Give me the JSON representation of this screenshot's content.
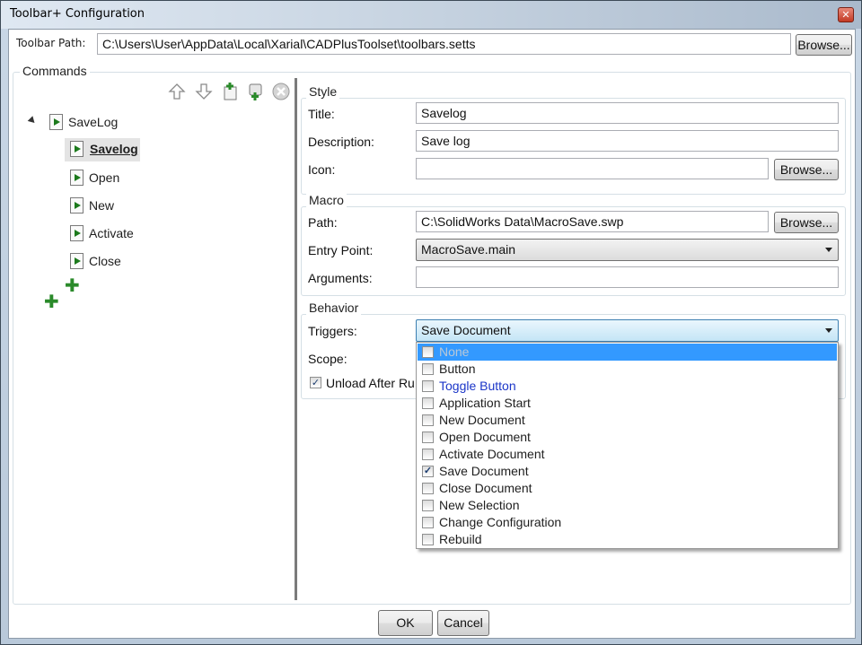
{
  "window": {
    "title": "Toolbar+ Configuration",
    "close_glyph": "✕"
  },
  "path_row": {
    "label": "Toolbar Path:",
    "value": "C:\\Users\\User\\AppData\\Local\\Xarial\\CADPlusToolset\\toolbars.setts",
    "browse": "Browse..."
  },
  "commands": {
    "legend": "Commands",
    "toolbar_icons": [
      "arrow-up-icon",
      "arrow-down-icon",
      "add-command-icon",
      "add-group-icon",
      "remove-icon"
    ],
    "root": {
      "label": "SaveLog",
      "expanded": true
    },
    "children": [
      {
        "label": "Savelog",
        "selected": true
      },
      {
        "label": "Open"
      },
      {
        "label": "New"
      },
      {
        "label": "Activate"
      },
      {
        "label": "Close"
      }
    ]
  },
  "style": {
    "legend": "Style",
    "title_label": "Title:",
    "title_value": "Savelog",
    "description_label": "Description:",
    "description_value": "Save log",
    "icon_label": "Icon:",
    "icon_value": "",
    "browse": "Browse..."
  },
  "macro": {
    "legend": "Macro",
    "path_label": "Path:",
    "path_value": "C:\\SolidWorks Data\\MacroSave.swp",
    "browse": "Browse...",
    "entry_label": "Entry Point:",
    "entry_value": "MacroSave.main",
    "args_label": "Arguments:",
    "args_value": ""
  },
  "behavior": {
    "legend": "Behavior",
    "triggers_label": "Triggers:",
    "triggers_value": "Save Document",
    "scope_label": "Scope:",
    "unload_label": "Unload After Ru",
    "unload_checked": true,
    "check_glyph": "✓"
  },
  "trigger_options": [
    {
      "label": "None",
      "checked": false,
      "state": "highlight-disabled"
    },
    {
      "label": "Button",
      "checked": false
    },
    {
      "label": "Toggle Button",
      "checked": false,
      "state": "blue"
    },
    {
      "label": "Application Start",
      "checked": false
    },
    {
      "label": "New Document",
      "checked": false
    },
    {
      "label": "Open Document",
      "checked": false
    },
    {
      "label": "Activate Document",
      "checked": false
    },
    {
      "label": "Save Document",
      "checked": true
    },
    {
      "label": "Close Document",
      "checked": false
    },
    {
      "label": "New Selection",
      "checked": false
    },
    {
      "label": "Change Configuration",
      "checked": false
    },
    {
      "label": "Rebuild",
      "checked": false
    }
  ],
  "footer": {
    "ok": "OK",
    "cancel": "Cancel"
  },
  "colors": {
    "accent": "#3399ff",
    "plus_green": "#2a8a2a",
    "link_blue": "#1b36c8"
  }
}
